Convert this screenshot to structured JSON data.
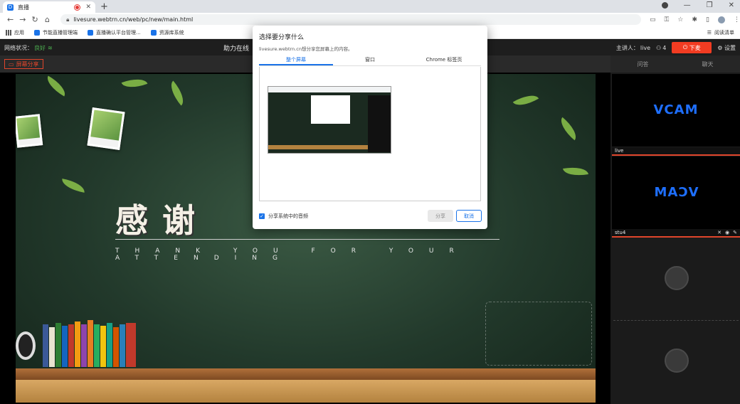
{
  "browser": {
    "tab_title": "直播",
    "new_tab_glyph": "+",
    "url": "livesure.webtrn.cn/web/pc/new/main.html",
    "bookmarks": [
      "应用",
      "节能直播管理端",
      "直播确认平台管理...",
      "资源库系统"
    ],
    "reading_list": "阅读清单"
  },
  "app": {
    "network_label": "网络状况：",
    "network_value": "良好",
    "title": "助力在线",
    "presenter_label": "主讲人：",
    "presenter_name": "live",
    "viewer_count": "4",
    "end_button": "下麦",
    "settings": "设置",
    "share_screen_button": "屏幕分享"
  },
  "slide": {
    "title_cn": "感谢",
    "subtitle_en": "THANK YOU FOR YOUR ATTENDING"
  },
  "panel": {
    "tabs": [
      "问答",
      "聊天"
    ],
    "tiles": [
      {
        "cam_text": "VCAM",
        "label": "live"
      },
      {
        "cam_text": "VCAM",
        "label": "stu4"
      }
    ]
  },
  "dialog": {
    "title": "选择要分享什么",
    "subtitle": "livesure.webtrn.cn想分享您屏幕上的内容。",
    "tabs": [
      "整个屏幕",
      "窗口",
      "Chrome 标签页"
    ],
    "active_tab": "整个屏幕",
    "checkbox_label": "分享系统中的音频",
    "share_button": "分享",
    "cancel_button": "取消"
  },
  "colors": {
    "accent_red": "#f23c22",
    "accent_blue": "#1a73e8",
    "vcam_blue": "#1e6fff",
    "good_green": "#4caf50"
  }
}
